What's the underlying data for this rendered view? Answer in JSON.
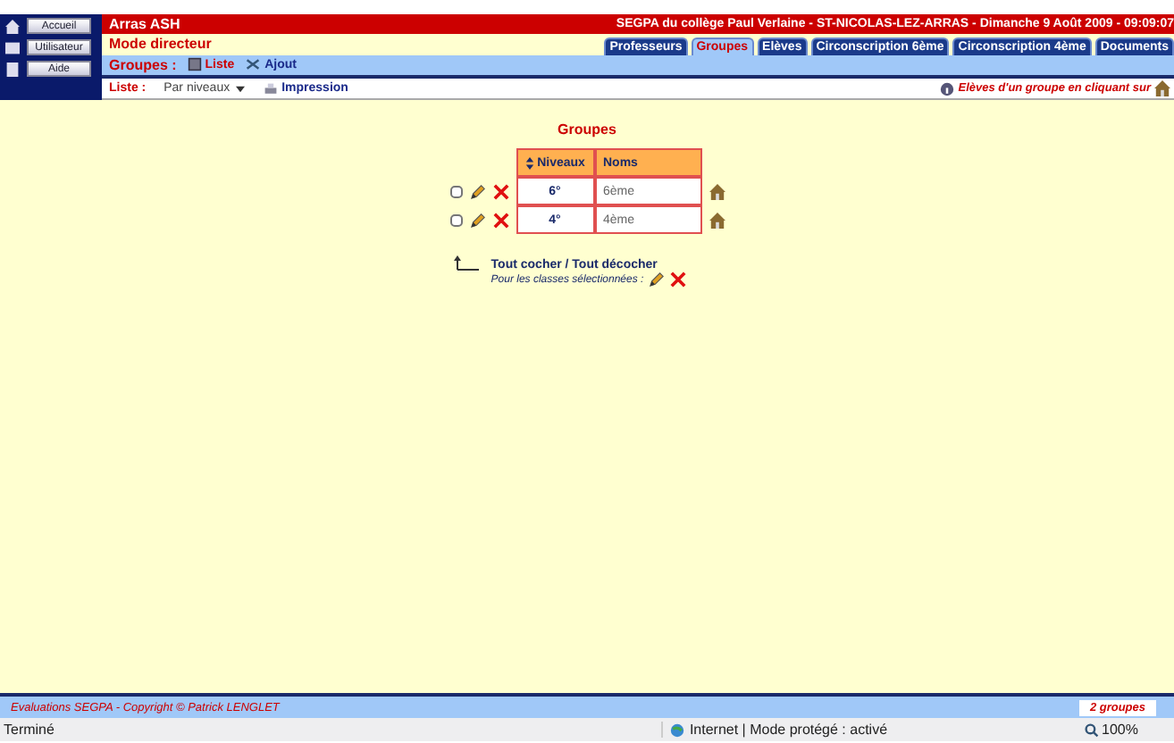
{
  "nav_buttons": [
    "Accueil",
    "Utilisateur",
    "Aide"
  ],
  "header": {
    "site": "Arras ASH",
    "school": "SEGPA du collège Paul Verlaine - ST-NICOLAS-LEZ-ARRAS - Dimanche 9 Août 2009 - 09:09:07"
  },
  "mode": "Mode directeur",
  "tabs": [
    {
      "label": "Professeurs",
      "selected": false
    },
    {
      "label": "Groupes",
      "selected": true
    },
    {
      "label": "Elèves",
      "selected": false
    },
    {
      "label": "Circonscription 6ème",
      "selected": false
    },
    {
      "label": "Circonscription 4ème",
      "selected": false
    },
    {
      "label": "Documents",
      "selected": false
    }
  ],
  "toolbar": {
    "label": "Groupes :",
    "actions": [
      "Liste",
      "Ajout"
    ]
  },
  "list_bar": {
    "label": "Liste :",
    "sort": "Par niveaux",
    "print": "Impression",
    "hint": "Elèves d'un groupe en cliquant sur"
  },
  "groups": {
    "title": "Groupes",
    "columns": [
      "Niveaux",
      "Noms"
    ],
    "rows": [
      {
        "level": "6°",
        "name": "6ème",
        "checked": false
      },
      {
        "level": "4°",
        "name": "4ème",
        "checked": false
      }
    ],
    "select_all": "Tout cocher / Tout décocher",
    "selected_actions": "Pour les classes sélectionnées :"
  },
  "footer": {
    "copyright": "Evaluations SEGPA - Copyright © Patrick LENGLET",
    "count": "2 groupes"
  },
  "status_bar": {
    "state": "Terminé",
    "zone": "Internet | Mode protégé : activé",
    "zoom": "100%"
  }
}
